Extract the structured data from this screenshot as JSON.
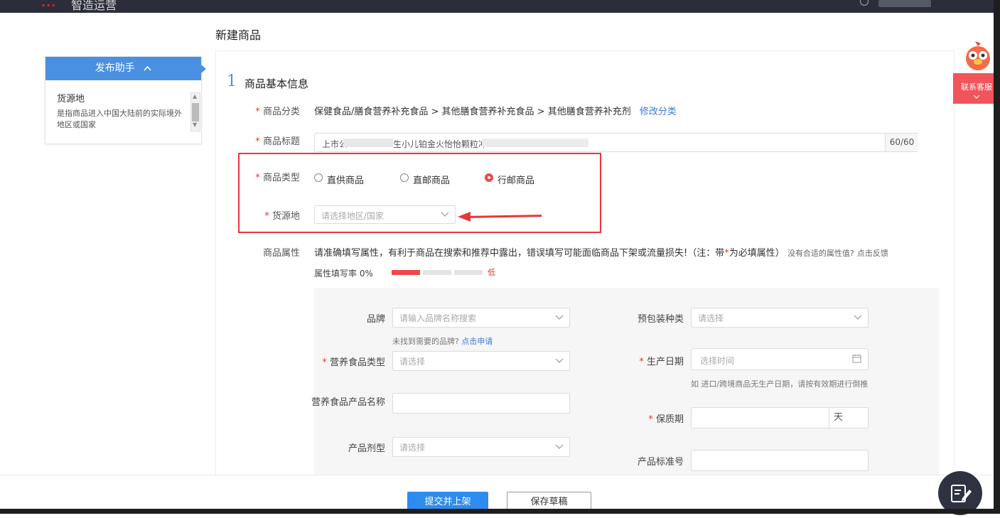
{
  "topbar": {
    "logo_red": "...",
    "logo_text": "智造运营"
  },
  "page_title": "新建商品",
  "helper": {
    "header": "发布助手",
    "title": "货源地",
    "desc": "是指商品进入中国大陆前的实际境外地区或国家"
  },
  "section": {
    "num": "1",
    "title": "商品基本信息"
  },
  "fields": {
    "category_label": "商品分类",
    "category_value": "保健食品/膳食营养补充食品 > 其他膳食营养补充食品 > 其他膳食营养补充剂",
    "category_link": "修改分类",
    "title_label": "商品标题",
    "title_value": "上市公",
    "title_value2": "生小儿铂金火怡怡颗粒冲",
    "title_count": "60/60",
    "type_label": "商品类型",
    "type_options": [
      "直供商品",
      "直邮商品",
      "行邮商品"
    ],
    "type_selected": "行邮商品",
    "origin_label": "货源地",
    "origin_placeholder": "请选择地区/国家"
  },
  "attributes": {
    "label": "商品属性",
    "desc": "请准确填写属性，有利于商品在搜索和推荐中露出，错误填写可能面临商品下架或流量损失!（注：带",
    "desc_star": "*",
    "desc_end": "为必填属性）",
    "no_attr": "没有合适的属性值?",
    "feedback": "点击反馈",
    "fill_rate_label": "属性填写率 0%",
    "fill_rate": 0,
    "fill_level": "低"
  },
  "form": {
    "brand_label": "品牌",
    "brand_placeholder": "请输入品牌名称搜索",
    "brand_hint": "未找到需要的品牌?",
    "brand_hint_link": "点击申请",
    "pack_label": "预包装种类",
    "pack_placeholder": "请选择",
    "nutri_type_label": "营养食品类型",
    "nutri_type_placeholder": "请选择",
    "prod_date_label": "生产日期",
    "prod_date_placeholder": "选择时间",
    "prod_date_hint": "如 进口/跨境商品无生产日期，请按有效期进行倒推",
    "nutri_name_label": "营养食品产品名称",
    "shelf_label": "保质期",
    "shelf_unit": "天",
    "dosage_label": "产品剂型",
    "dosage_placeholder": "请选择",
    "standard_label": "产品标准号"
  },
  "footer": {
    "submit": "提交并上架",
    "draft": "保存草稿"
  },
  "service": {
    "label": "联系客服"
  }
}
